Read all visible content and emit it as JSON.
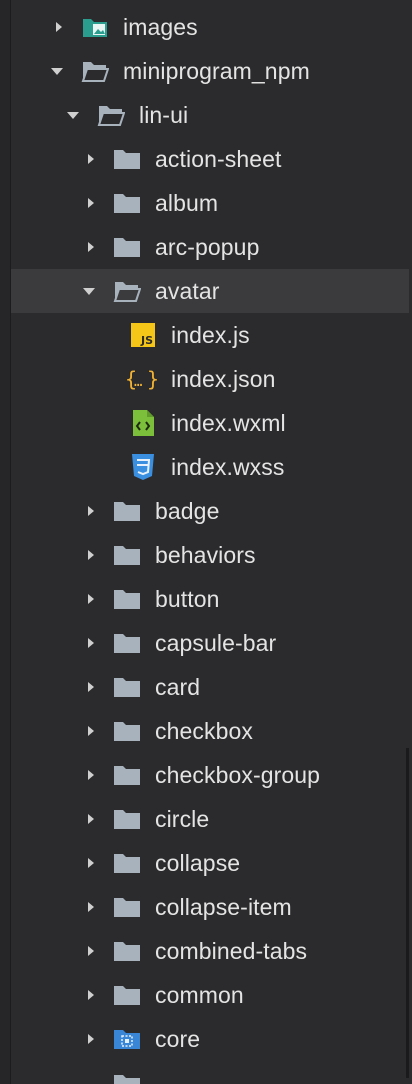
{
  "tree": {
    "items": [
      {
        "label": "images",
        "icon": "image-folder-icon",
        "expanded": false
      },
      {
        "label": "miniprogram_npm",
        "icon": "folder-open-icon",
        "expanded": true
      },
      {
        "label": "lin-ui",
        "icon": "folder-open-icon",
        "expanded": true
      },
      {
        "label": "action-sheet",
        "icon": "folder-icon",
        "expanded": false
      },
      {
        "label": "album",
        "icon": "folder-icon",
        "expanded": false
      },
      {
        "label": "arc-popup",
        "icon": "folder-icon",
        "expanded": false
      },
      {
        "label": "avatar",
        "icon": "folder-open-icon",
        "expanded": true,
        "selected": true
      },
      {
        "label": "index.js",
        "icon": "js-file-icon"
      },
      {
        "label": "index.json",
        "icon": "json-file-icon"
      },
      {
        "label": "index.wxml",
        "icon": "wxml-file-icon"
      },
      {
        "label": "index.wxss",
        "icon": "css-file-icon"
      },
      {
        "label": "badge",
        "icon": "folder-icon",
        "expanded": false
      },
      {
        "label": "behaviors",
        "icon": "folder-icon",
        "expanded": false
      },
      {
        "label": "button",
        "icon": "folder-icon",
        "expanded": false
      },
      {
        "label": "capsule-bar",
        "icon": "folder-icon",
        "expanded": false
      },
      {
        "label": "card",
        "icon": "folder-icon",
        "expanded": false
      },
      {
        "label": "checkbox",
        "icon": "folder-icon",
        "expanded": false
      },
      {
        "label": "checkbox-group",
        "icon": "folder-icon",
        "expanded": false
      },
      {
        "label": "circle",
        "icon": "folder-icon",
        "expanded": false
      },
      {
        "label": "collapse",
        "icon": "folder-icon",
        "expanded": false
      },
      {
        "label": "collapse-item",
        "icon": "folder-icon",
        "expanded": false
      },
      {
        "label": "combined-tabs",
        "icon": "folder-icon",
        "expanded": false
      },
      {
        "label": "common",
        "icon": "folder-icon",
        "expanded": false
      },
      {
        "label": "core",
        "icon": "core-folder-icon",
        "expanded": false
      }
    ]
  },
  "colors": {
    "background": "#2b2b2d",
    "selected_row": "#3b3b3e",
    "folder": "#a7b2bc",
    "js_badge": "#f5c518",
    "json_braces": "#f2b233",
    "wxml_file": "#7bbf3a",
    "css_shield": "#3b8fe0",
    "core_folder": "#3a86d6",
    "image_folder": "#2a9d8f"
  }
}
